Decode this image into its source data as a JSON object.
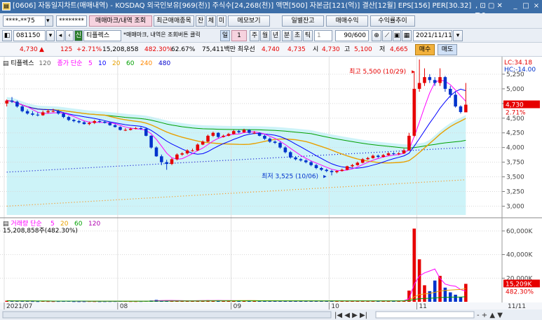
{
  "window": {
    "title": "[0606] 자동일지차트(매매내역) - KOSDAQ 외국인보유[969(천)] 주식수[24,268(천)] 액면[500] 자본금[121(억)] 결산[12월] EPS[156] PER[30.32]",
    "controls": ", ⊡ ▢ ✕ T ?",
    "minimize": "_",
    "maximize": "□",
    "close": "×"
  },
  "toolbar1": {
    "account": "****-**75",
    "password": "********",
    "trade_mark_button": "매매마크/내역 조회",
    "recent_button": "최근매매종목",
    "tab_jan": "잔",
    "tab_che": "체",
    "tab_mi": "미",
    "memo_button": "메모보기",
    "daily_balance_button": "일별잔고",
    "trade_profit_button": "매매수익",
    "profit_rate_button": "수익률추이"
  },
  "toolbar2": {
    "stock_code": "081150",
    "stock_name": "티플렉스",
    "notice": "*매매마크, 내역은 조회버튼 클릭",
    "period_day": "일",
    "period_num": "1",
    "period_week": "주",
    "period_month": "월",
    "period_year": "년",
    "period_min": "분",
    "period_sec": "초",
    "period_tick": "틱",
    "tick_num": "1",
    "count": "90/600",
    "date": "2021/11/11"
  },
  "quote": {
    "price": "4,730",
    "price_arrow": "▲",
    "change": "125",
    "change_pct": "+2.71%",
    "volume": "15,208,858",
    "volume_pct": "482.30%",
    "ratio": "62.67%",
    "priority_label": "75,411백만 최우선",
    "ask": "4,740",
    "bid": "4,735",
    "open_label": "시",
    "open": "4,730",
    "high_label": "고",
    "high": "5,100",
    "low_label": "저",
    "low": "4,665",
    "buy_button": "매수",
    "sell_button": "매도"
  },
  "chart_labels": {
    "price_stock": "티플렉스",
    "price_period": "120",
    "price_ma_label": "종가 단순",
    "lc": "LC:34.18",
    "hc": "HC:-14.00",
    "high_annotation": "최고 5,500 (10/29)",
    "low_annotation": "최저 3,525 (10/06)",
    "current_price_tag": "4,730",
    "current_pct_tag": "2.71%",
    "volume_title": "거래량 단순",
    "volume_summary": "15,208,858주(482.30%)",
    "volume_tag": "15,209K",
    "volume_pct_tag": "482.30%",
    "x_right_label": "11/11"
  },
  "colors": {
    "up": "#e60000",
    "down": "#0033cc",
    "ma5": "#ff00ff",
    "ma10": "#0000ff",
    "ma20": "#e8a000",
    "ma60": "#00a000",
    "ma120": "#b000b0",
    "ma240": "#ff8800",
    "ma480": "#0000cc",
    "band_fill": "#cdf3f8"
  },
  "chart_data": [
    {
      "type": "candlestick",
      "title": "",
      "x": [
        "2021/07/01",
        "2021/07/02",
        "2021/07/05",
        "2021/07/06",
        "2021/07/07",
        "2021/07/08",
        "2021/07/09",
        "2021/07/12",
        "2021/07/13",
        "2021/07/14",
        "2021/07/15",
        "2021/07/16",
        "2021/07/19",
        "2021/07/20",
        "2021/07/21",
        "2021/07/22",
        "2021/07/23",
        "2021/07/26",
        "2021/07/27",
        "2021/07/28",
        "2021/07/29",
        "2021/07/30",
        "2021/08/02",
        "2021/08/03",
        "2021/08/04",
        "2021/08/05",
        "2021/08/06",
        "2021/08/09",
        "2021/08/10",
        "2021/08/11",
        "2021/08/12",
        "2021/08/13",
        "2021/08/17",
        "2021/08/18",
        "2021/08/19",
        "2021/08/20",
        "2021/08/23",
        "2021/08/24",
        "2021/08/25",
        "2021/08/26",
        "2021/08/27",
        "2021/08/30",
        "2021/08/31",
        "2021/09/01",
        "2021/09/02",
        "2021/09/03",
        "2021/09/06",
        "2021/09/07",
        "2021/09/08",
        "2021/09/09",
        "2021/09/10",
        "2021/09/13",
        "2021/09/14",
        "2021/09/15",
        "2021/09/16",
        "2021/09/17",
        "2021/09/23",
        "2021/09/24",
        "2021/09/27",
        "2021/09/28",
        "2021/09/29",
        "2021/09/30",
        "2021/10/01",
        "2021/10/05",
        "2021/10/06",
        "2021/10/07",
        "2021/10/08",
        "2021/10/12",
        "2021/10/13",
        "2021/10/14",
        "2021/10/15",
        "2021/10/18",
        "2021/10/19",
        "2021/10/20",
        "2021/10/21",
        "2021/10/22",
        "2021/10/25",
        "2021/10/26",
        "2021/10/27",
        "2021/10/28",
        "2021/10/29",
        "2021/11/01",
        "2021/11/02",
        "2021/11/03",
        "2021/11/04",
        "2021/11/05",
        "2021/11/08",
        "2021/11/09",
        "2021/11/10",
        "2021/11/11"
      ],
      "open": [
        4750,
        4800,
        4780,
        4700,
        4620,
        4580,
        4560,
        4550,
        4600,
        4620,
        4620,
        4580,
        4520,
        4470,
        4450,
        4430,
        4400,
        4420,
        4450,
        4440,
        4420,
        4380,
        4350,
        4300,
        4300,
        4320,
        4330,
        4320,
        4200,
        4000,
        3850,
        3750,
        3720,
        3800,
        3880,
        3900,
        3950,
        3950,
        4050,
        4100,
        4200,
        4250,
        4180,
        4200,
        4230,
        4280,
        4260,
        4300,
        4250,
        4250,
        4200,
        4150,
        4100,
        4080,
        4000,
        3920,
        3830,
        3800,
        3780,
        3750,
        3700,
        3650,
        3620,
        3600,
        3580,
        3600,
        3620,
        3680,
        3700,
        3740,
        3800,
        3820,
        3860,
        3840,
        3870,
        3900,
        3890,
        3900,
        3950,
        4200,
        5000,
        5100,
        5200,
        5150,
        5100,
        5200,
        5000,
        4900,
        4700,
        4600
      ],
      "close": [
        4800,
        4780,
        4700,
        4620,
        4580,
        4560,
        4550,
        4600,
        4620,
        4620,
        4580,
        4520,
        4470,
        4450,
        4430,
        4400,
        4420,
        4450,
        4440,
        4420,
        4380,
        4350,
        4300,
        4300,
        4320,
        4330,
        4320,
        4200,
        4000,
        3850,
        3750,
        3720,
        3800,
        3880,
        3900,
        3950,
        3950,
        4050,
        4100,
        4200,
        4250,
        4180,
        4200,
        4230,
        4280,
        4260,
        4300,
        4250,
        4250,
        4200,
        4150,
        4100,
        4080,
        4000,
        3920,
        3830,
        3800,
        3780,
        3750,
        3700,
        3650,
        3620,
        3600,
        3580,
        3600,
        3620,
        3680,
        3700,
        3740,
        3800,
        3820,
        3860,
        3840,
        3870,
        3900,
        3890,
        3900,
        3950,
        4200,
        5000,
        5100,
        5200,
        5150,
        5100,
        5200,
        5000,
        4900,
        4700,
        4605,
        4730
      ],
      "high": [
        4820,
        4860,
        4800,
        4720,
        4650,
        4620,
        4600,
        4630,
        4650,
        4660,
        4640,
        4600,
        4540,
        4490,
        4470,
        4450,
        4440,
        4470,
        4470,
        4460,
        4440,
        4400,
        4360,
        4330,
        4340,
        4350,
        4350,
        4330,
        4210,
        4020,
        3880,
        3790,
        3820,
        3900,
        3920,
        3970,
        3980,
        4070,
        4120,
        4220,
        4270,
        4260,
        4220,
        4250,
        4300,
        4300,
        4320,
        4310,
        4280,
        4260,
        4220,
        4170,
        4120,
        4100,
        4020,
        3940,
        3850,
        3820,
        3800,
        3770,
        3720,
        3670,
        3640,
        3620,
        3610,
        3640,
        3690,
        3720,
        3760,
        3820,
        3840,
        3880,
        3880,
        3890,
        3920,
        3920,
        3920,
        3980,
        4250,
        5300,
        5500,
        5350,
        5250,
        5200,
        5350,
        5220,
        5050,
        4950,
        4720,
        5100
      ],
      "low": [
        4700,
        4760,
        4680,
        4600,
        4560,
        4540,
        4530,
        4540,
        4580,
        4600,
        4560,
        4500,
        4450,
        4430,
        4410,
        4390,
        4380,
        4400,
        4420,
        4410,
        4370,
        4340,
        4290,
        4280,
        4290,
        4310,
        4300,
        4190,
        3980,
        3840,
        3700,
        3620,
        3700,
        3780,
        3860,
        3880,
        3930,
        3940,
        4040,
        4090,
        4180,
        4160,
        4170,
        4190,
        4220,
        4240,
        4250,
        4240,
        4230,
        4190,
        4130,
        4080,
        4060,
        3980,
        3900,
        3810,
        3780,
        3760,
        3730,
        3680,
        3630,
        3600,
        3580,
        3525,
        3560,
        3590,
        3610,
        3660,
        3690,
        3730,
        3790,
        3810,
        3820,
        3830,
        3860,
        3870,
        3870,
        3890,
        3940,
        4180,
        4950,
        5050,
        5100,
        5050,
        5050,
        4950,
        4850,
        4680,
        4580,
        4665
      ],
      "ma5_title": "단순 5",
      "ma_periods": [
        "5",
        "10",
        "20",
        "60",
        "240",
        "480"
      ],
      "ylim": [
        2850,
        5500
      ],
      "y_ticks": [
        "5,250",
        "5,000",
        "4,750",
        "4,500",
        "4,250",
        "4,000",
        "3,750",
        "3,500",
        "3,250",
        "3,000"
      ],
      "x_labels": [
        "2021/07",
        "08",
        "09",
        "10",
        "11"
      ],
      "annotations": [
        {
          "label": "최고 5,500 (10/29)",
          "x": "2021/10/29",
          "y": 5500
        },
        {
          "label": "최저 3,525 (10/06)",
          "x": "2021/10/06",
          "y": 3525
        }
      ],
      "last_price": 4730,
      "last_pct": 2.71
    },
    {
      "type": "bar",
      "title": "",
      "ylim": [
        0,
        70000
      ],
      "y_ticks": [
        "60,000K",
        "40,000K",
        "20,000K"
      ],
      "ma_periods": [
        "5",
        "20",
        "60",
        "120"
      ],
      "values_k": [
        900,
        700,
        600,
        800,
        650,
        500,
        450,
        600,
        500,
        480,
        520,
        560,
        600,
        420,
        380,
        400,
        500,
        450,
        380,
        420,
        460,
        500,
        600,
        550,
        480,
        460,
        500,
        700,
        1100,
        1600,
        1200,
        900,
        800,
        900,
        950,
        1000,
        850,
        1000,
        1100,
        1300,
        1200,
        900,
        800,
        900,
        1000,
        900,
        950,
        850,
        800,
        750,
        700,
        800,
        750,
        700,
        800,
        900,
        750,
        700,
        650,
        750,
        800,
        700,
        650,
        900,
        700,
        650,
        800,
        700,
        750,
        900,
        850,
        800,
        750,
        800,
        900,
        850,
        800,
        1100,
        9500,
        62000,
        36000,
        14000,
        9000,
        18000,
        22000,
        12000,
        8000,
        6000,
        4000,
        15209
      ],
      "last_volume_k": 15209,
      "last_volume_pct": 482.3
    }
  ]
}
